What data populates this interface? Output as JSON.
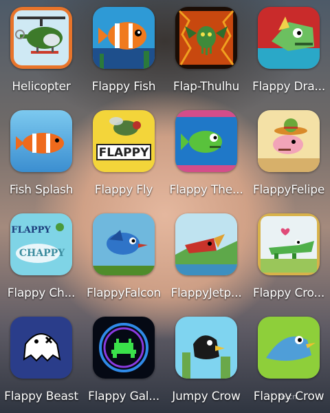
{
  "apps": [
    {
      "label": "Helicopter",
      "icon": "helicopter-icon"
    },
    {
      "label": "Flappy Fish",
      "icon": "clownfish-icon"
    },
    {
      "label": "Flap-Thulhu",
      "icon": "cthulhu-icon"
    },
    {
      "label": "Flappy Dra...",
      "icon": "dragon-icon"
    },
    {
      "label": "Fish Splash",
      "icon": "clownfish-icon"
    },
    {
      "label": "Flappy Fly",
      "icon": "fly-icon"
    },
    {
      "label": "Flappy The...",
      "icon": "green-fish-icon"
    },
    {
      "label": "FlappyFelipe",
      "icon": "sombrero-pig-icon"
    },
    {
      "label": "Flappy Ch...",
      "icon": "chappy-icon"
    },
    {
      "label": "FlappyFalcon",
      "icon": "blue-bird-icon"
    },
    {
      "label": "FlappyJetp...",
      "icon": "jetpack-icon"
    },
    {
      "label": "Flappy Cro...",
      "icon": "crocodile-icon"
    },
    {
      "label": "Flappy Beast",
      "icon": "ghost-beast-icon"
    },
    {
      "label": "Flappy Gal...",
      "icon": "space-invader-icon"
    },
    {
      "label": "Jumpy Crow",
      "icon": "crow-icon"
    },
    {
      "label": "Flappy Crow",
      "icon": "crow-fish-icon"
    }
  ],
  "watermark": "fe.cn"
}
